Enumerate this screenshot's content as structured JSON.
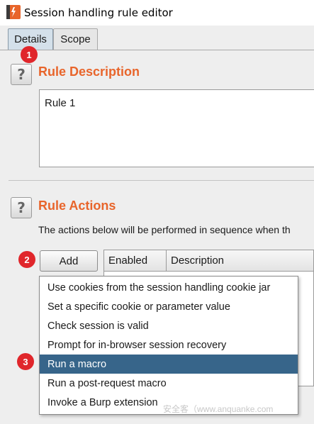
{
  "window": {
    "title": "Session handling rule editor"
  },
  "tabs": [
    {
      "label": "Details",
      "active": true
    },
    {
      "label": "Scope",
      "active": false
    }
  ],
  "rule_description": {
    "heading": "Rule Description",
    "help_label": "?",
    "text": "Rule 1"
  },
  "rule_actions": {
    "heading": "Rule Actions",
    "help_label": "?",
    "subtext": "The actions below will be performed in sequence when th",
    "add_label": "Add",
    "columns": [
      "Enabled",
      "Description"
    ]
  },
  "menu": {
    "items": [
      "Use cookies from the session handling cookie jar",
      "Set a specific cookie or parameter value",
      "Check session is valid",
      "Prompt for in-browser session recovery",
      "Run a macro",
      "Run a post-request macro",
      "Invoke a Burp extension"
    ],
    "selected": "Run a macro"
  },
  "badges": [
    "1",
    "2",
    "3"
  ],
  "watermark": "安全客（www.anquanke.com",
  "colors": {
    "heading": "#e8652b",
    "selection": "#37658a",
    "badge": "#e0262b"
  }
}
